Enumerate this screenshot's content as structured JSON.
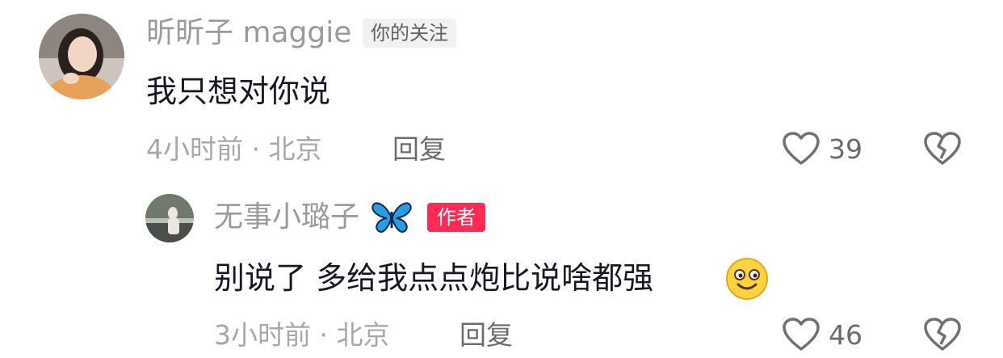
{
  "comments": [
    {
      "username": "昕昕子 maggie",
      "tag": "你的关注",
      "text": "我只想对你说",
      "time_location": "4小时前 · 北京",
      "reply_label": "回复",
      "likes": "39"
    },
    {
      "username": "无事小璐子",
      "username_emoji": "butterfly-emoji",
      "tag": "作者",
      "text": "别说了 多给我点点炮比说啥都强",
      "text_emoji": "smiling-face-emoji",
      "time_location": "3小时前 · 北京",
      "reply_label": "回复",
      "likes": "46"
    }
  ],
  "colors": {
    "author_tag": "#fe2c55",
    "follow_tag_bg": "#f1f1f2",
    "butterfly": "#2a9de0"
  }
}
